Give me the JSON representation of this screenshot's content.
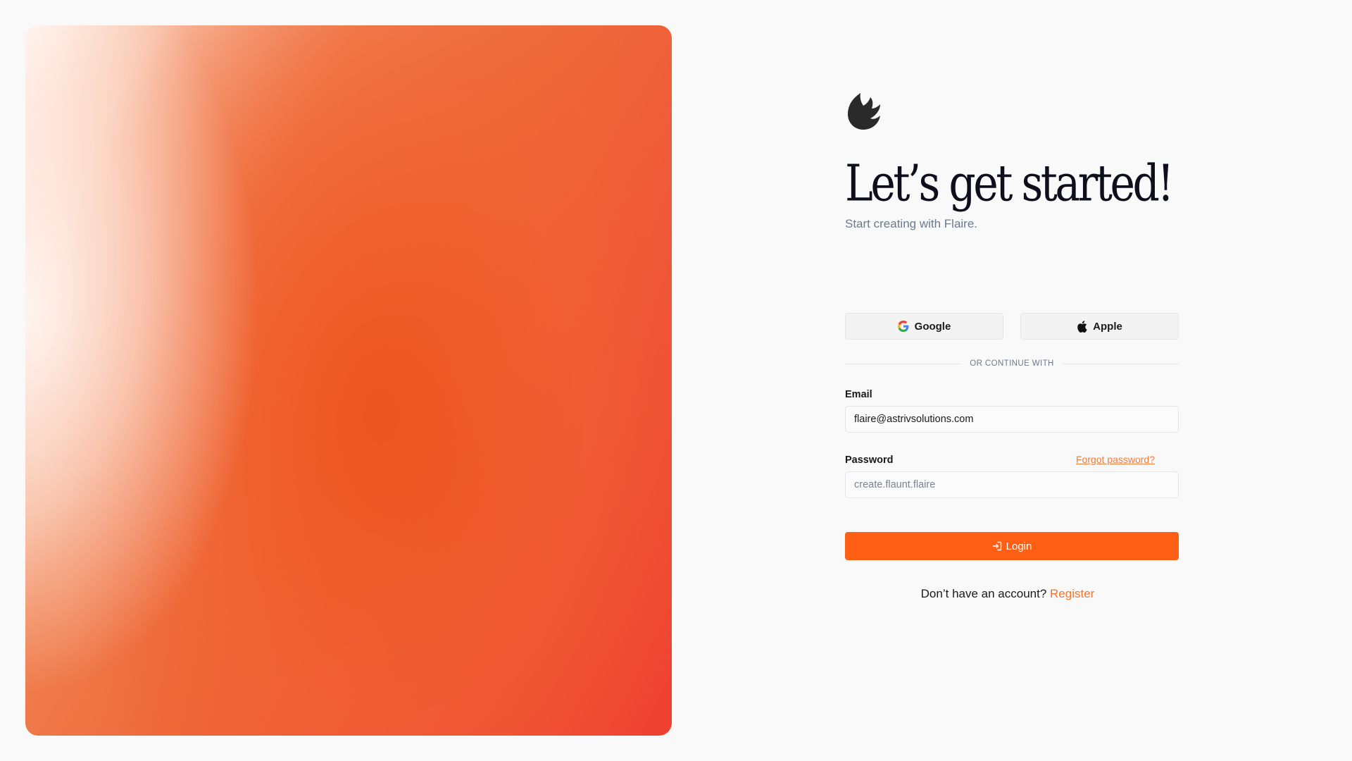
{
  "brand": {
    "logo_icon": "flame-icon"
  },
  "heading": {
    "title": "Let’s get started!",
    "subtitle": "Start creating with Flaire."
  },
  "social": {
    "google_label": "Google",
    "google_icon": "google-icon",
    "apple_label": "Apple",
    "apple_icon": "apple-icon",
    "divider_text": "OR CONTINUE WITH"
  },
  "form": {
    "email_label": "Email",
    "email_value": "flaire@astrivsolutions.com",
    "password_label": "Password",
    "password_placeholder": "create.flaunt.flaire",
    "forgot_label": "Forgot password?",
    "login_label": "Login",
    "login_icon": "login-icon"
  },
  "footer": {
    "prompt": "Don’t have an account?",
    "register_label": "Register"
  },
  "colors": {
    "accent": "#fe5f14",
    "link": "#f07c3c",
    "background": "#f9f9f9"
  }
}
